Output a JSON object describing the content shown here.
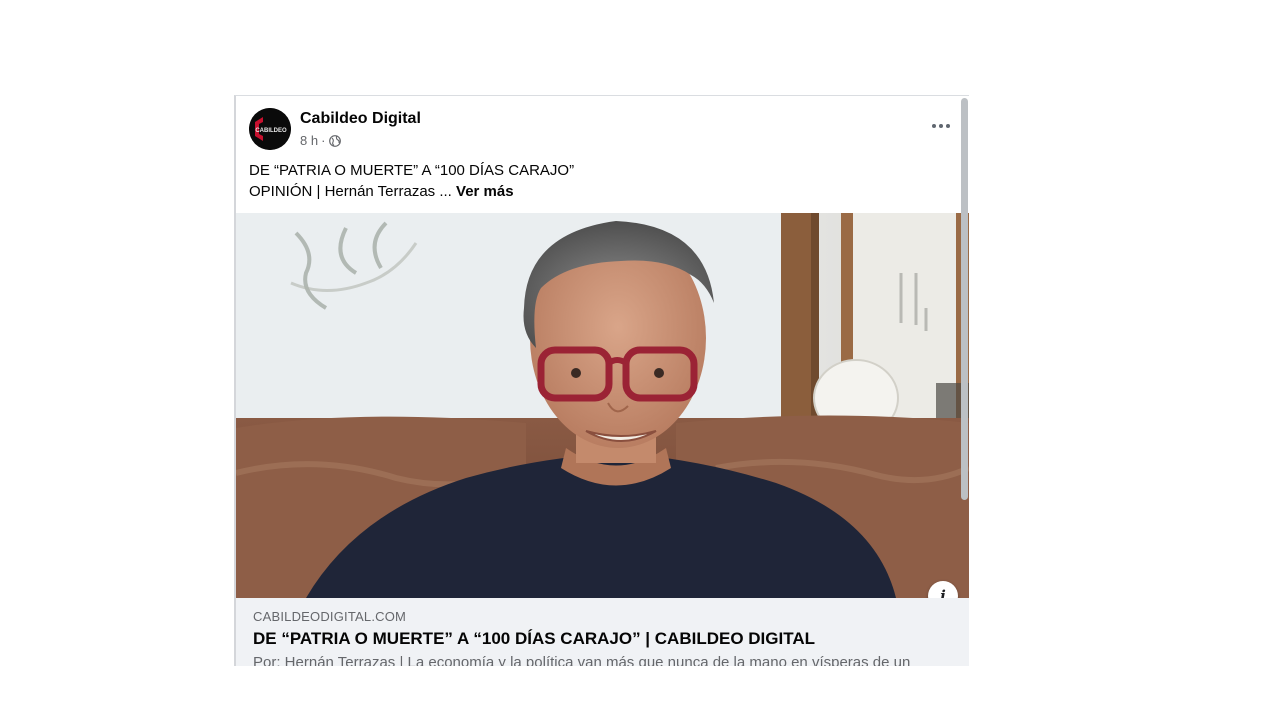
{
  "post": {
    "page_name": "Cabildeo Digital",
    "time": "8 h",
    "separator": "·",
    "audience_icon": "globe-icon",
    "more_icon": "more-horizontal-icon",
    "text_line1": "DE “PATRIA O MUERTE” A “100 DÍAS CARAJO”",
    "text_line2": "OPINIÓN | Hernán Terrazas ... ",
    "see_more": "Ver más",
    "avatar_logo_text": "CABILDEO",
    "info_label": "i"
  },
  "link_preview": {
    "domain": "CABILDEODIGITAL.COM",
    "title": "DE “PATRIA O MUERTE” A “100 DÍAS CARAJO” | CABILDEO DIGITAL",
    "description": "Por: Hernán Terrazas | La economía y la política van más que nunca de la mano en vísperas de un"
  },
  "colors": {
    "primary_text": "#050505",
    "secondary_text": "#65676b",
    "card_background": "#f0f2f5",
    "logo_accent": "#c8102e"
  }
}
